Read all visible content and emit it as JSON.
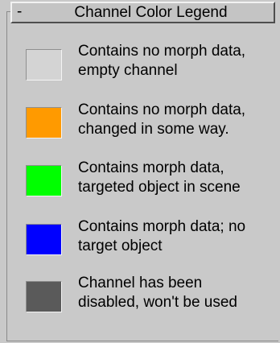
{
  "panel": {
    "collapse_sign": "-",
    "title": "Channel Color Legend"
  },
  "legend": [
    {
      "color": "#d4d4d4",
      "line1": "Contains no morph data,",
      "line2": "empty channel"
    },
    {
      "color": "#ff9a00",
      "line1": "Contains no morph data,",
      "line2": "changed in some way."
    },
    {
      "color": "#00ff00",
      "line1": "Contains morph data,",
      "line2": "targeted object in scene"
    },
    {
      "color": "#0000ff",
      "line1": "Contains morph data; no",
      "line2": "target object"
    },
    {
      "color": "#5a5a5a",
      "line1": "Channel has been",
      "line2": "disabled, won't be used"
    }
  ]
}
